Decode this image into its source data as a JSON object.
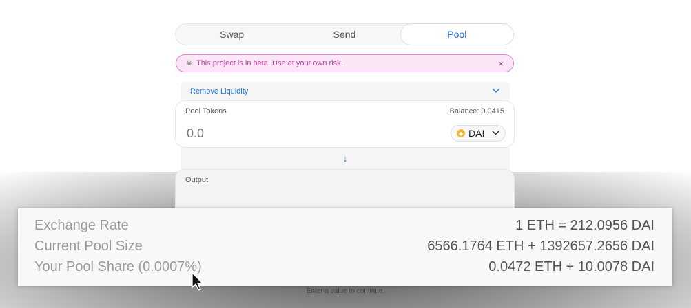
{
  "tabs": [
    {
      "label": "Swap"
    },
    {
      "label": "Send"
    },
    {
      "label": "Pool",
      "active": true
    }
  ],
  "beta_banner": {
    "icon": "skull-icon",
    "text": "This project is in beta. Use at your own risk.",
    "close": "×"
  },
  "mode_select": {
    "label": "Remove Liquidity",
    "icon": "chevron-down-icon"
  },
  "pool_tokens": {
    "label": "Pool Tokens",
    "balance": "Balance: 0.0415",
    "placeholder": "0.0",
    "token": "DAI"
  },
  "output": {
    "label": "Output"
  },
  "status": {
    "message": "Enter a value to continue."
  },
  "zoom_details": {
    "rows": [
      {
        "label": "Exchange Rate",
        "value": "1 ETH = 212.0956 DAI"
      },
      {
        "label": "Current Pool Size",
        "value": "6566.1764 ETH + 1392657.2656 DAI"
      },
      {
        "label": "Your Pool Share (0.0007%)",
        "value": "0.0472 ETH + 10.0078 DAI"
      }
    ]
  },
  "colors": {
    "accent": "#2172e5",
    "beta_bg": "#fbe6f8",
    "beta_border": "#e87fd5",
    "dai": "#f4b731"
  }
}
